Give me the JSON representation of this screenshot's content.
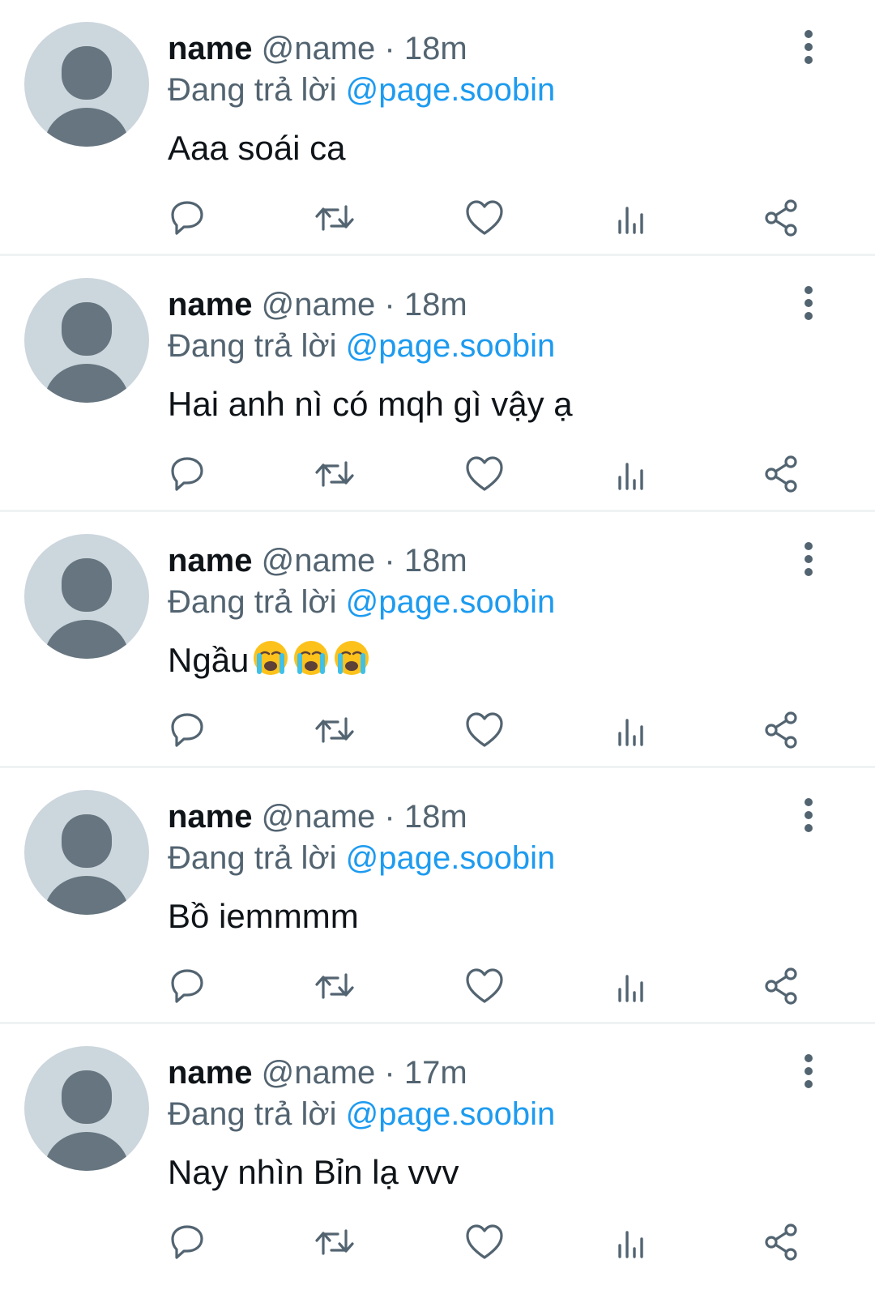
{
  "colors": {
    "name": "#0f1419",
    "secondary": "#536471",
    "mention": "#1d9bf0",
    "avatar_bg": "#ccd6dd",
    "avatar_fg": "#66757f",
    "divider": "#eff3f4"
  },
  "icons": [
    "avatar-icon",
    "more-icon",
    "reply-icon",
    "retweet-icon",
    "like-icon",
    "views-icon",
    "share-icon",
    "crying-face-emoji"
  ],
  "tweets": [
    {
      "name": "name",
      "handle": "@name",
      "time": "· 18m",
      "reply_prefix": "Đang trả lời",
      "mention": "@page.soobin",
      "text": "Aaa soái ca"
    },
    {
      "name": "name",
      "handle": "@name",
      "time": "· 18m",
      "reply_prefix": "Đang trả lời",
      "mention": "@page.soobin",
      "text": "Hai anh nì có mqh gì vậy ạ"
    },
    {
      "name": "name",
      "handle": "@name",
      "time": "· 18m",
      "reply_prefix": "Đang trả lời",
      "mention": "@page.soobin",
      "text": "Ngầu",
      "emoji_count": 3
    },
    {
      "name": "name",
      "handle": "@name",
      "time": "· 18m",
      "reply_prefix": "Đang trả lời",
      "mention": "@page.soobin",
      "text": "Bồ iemmmm"
    },
    {
      "name": "name",
      "handle": "@name",
      "time": "· 17m",
      "reply_prefix": "Đang trả lời",
      "mention": "@page.soobin",
      "text": "Nay nhìn Bỉn lạ vvv"
    }
  ]
}
